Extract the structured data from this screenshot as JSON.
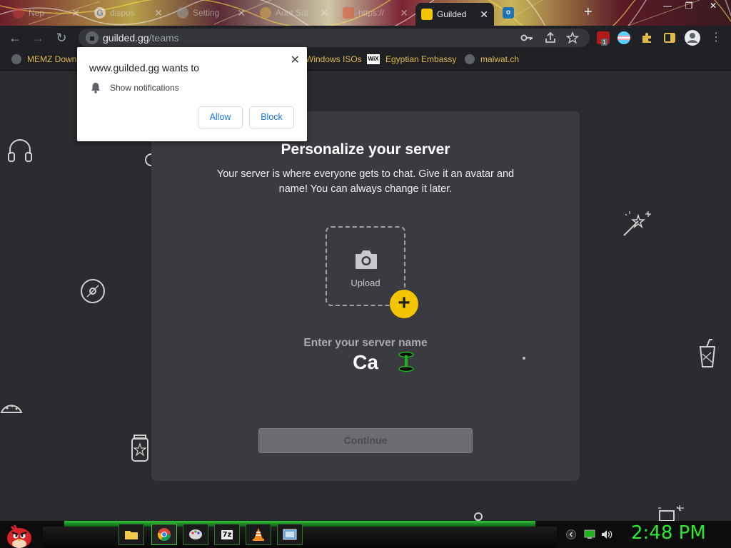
{
  "browser": {
    "tabs": [
      {
        "title": "Nep",
        "favicon_color": "#c23b3b"
      },
      {
        "title": "dispos",
        "favicon_color": "#ffffff"
      },
      {
        "title": "Setting",
        "favicon_color": "#9aa0a6"
      },
      {
        "title": "Aunt Sal",
        "favicon_color": "#d8a64c"
      },
      {
        "title": "https://",
        "favicon_color": "#e05a3a"
      },
      {
        "title": "Guilded",
        "favicon_color": "#f5c400",
        "active": true
      },
      {
        "title": "",
        "favicon_color": "#0f6cbd"
      }
    ],
    "new_tab_symbol": "+",
    "window_controls": [
      "—",
      "❐",
      "✕"
    ],
    "url_host": "guilded.gg",
    "url_path": "/teams",
    "ublock_badge": "1"
  },
  "bookmarks": [
    {
      "label": "MEMZ Down",
      "icon": "globe-icon"
    },
    {
      "label": "Windows ISOs",
      "icon": "globe-icon"
    },
    {
      "label": "Egyptian Embassy",
      "icon": "wix-icon"
    },
    {
      "label": "malwat.ch",
      "icon": "globe-icon"
    }
  ],
  "permission_popup": {
    "title": "www.guilded.gg wants to",
    "item": "Show notifications",
    "allow_label": "Allow",
    "block_label": "Block",
    "close_symbol": "✕"
  },
  "modal": {
    "title": "Personalize your server",
    "description": "Your server is where everyone gets to chat. Give it an avatar and name! You can always change it later.",
    "upload_label": "Upload",
    "add_symbol": "+",
    "name_label": "Enter your server name",
    "name_value": "Ca",
    "continue_label": "Continue"
  },
  "taskbar": {
    "clock": "2:48 PM"
  },
  "colors": {
    "accent": "#f5c400",
    "link_blue": "#1a73e8",
    "bookmark_text": "#e0b94b",
    "clock_green": "#2ee82e"
  }
}
